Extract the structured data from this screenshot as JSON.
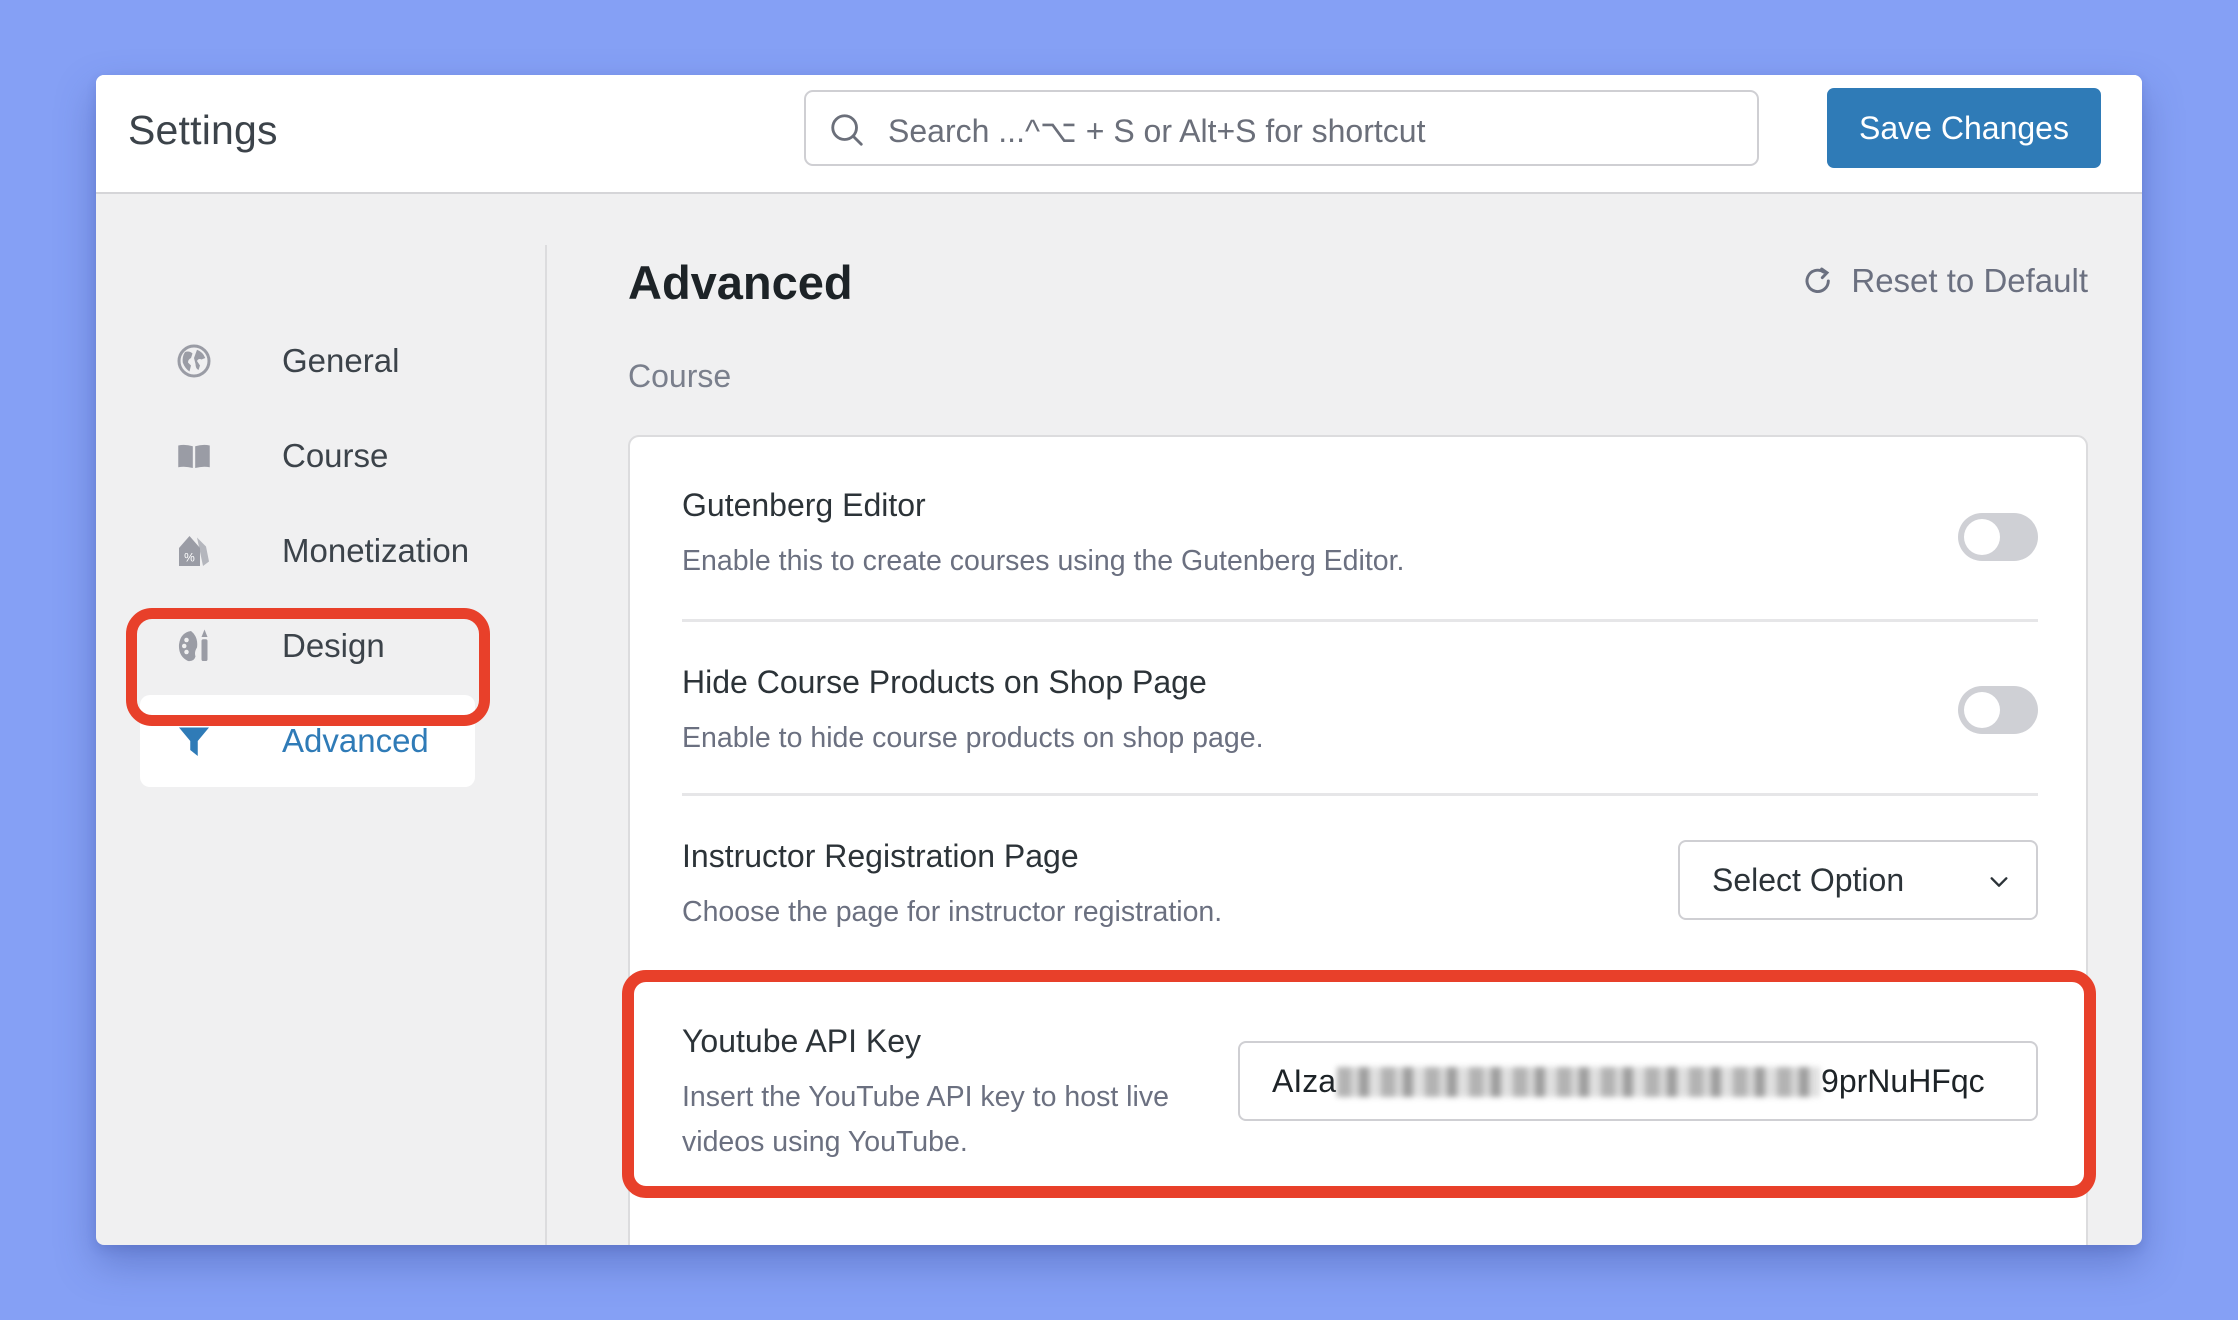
{
  "header": {
    "title": "Settings",
    "search_placeholder": "Search ...^⌥ + S or Alt+S for shortcut",
    "save_label": "Save Changes"
  },
  "sidebar": {
    "items": [
      {
        "label": "General",
        "icon": "globe-icon",
        "active": false
      },
      {
        "label": "Course",
        "icon": "book-icon",
        "active": false
      },
      {
        "label": "Monetization",
        "icon": "price-tag-icon",
        "active": false
      },
      {
        "label": "Design",
        "icon": "palette-icon",
        "active": false
      },
      {
        "label": "Advanced",
        "icon": "filter-icon",
        "active": true
      }
    ]
  },
  "main": {
    "heading": "Advanced",
    "reset_label": "Reset to Default",
    "section_label": "Course",
    "settings": [
      {
        "title": "Gutenberg Editor",
        "description": "Enable this to create courses using the Gutenberg Editor.",
        "control": "toggle",
        "enabled": false
      },
      {
        "title": "Hide Course Products on Shop Page",
        "description": "Enable to hide course products on shop page.",
        "control": "toggle",
        "enabled": false
      },
      {
        "title": "Instructor Registration Page",
        "description": "Choose the page for instructor registration.",
        "control": "select",
        "selected": "Select Option"
      },
      {
        "title": "Youtube API Key",
        "description": "Insert the YouTube API key to host live videos using YouTube.",
        "control": "text",
        "value_prefix": "AIza",
        "value_suffix": "9prNuHFqc",
        "value_obscured": true
      }
    ]
  },
  "colors": {
    "accent": "#2f7bb7",
    "highlight_outline": "#e8402a",
    "background": "#85a0f5"
  }
}
